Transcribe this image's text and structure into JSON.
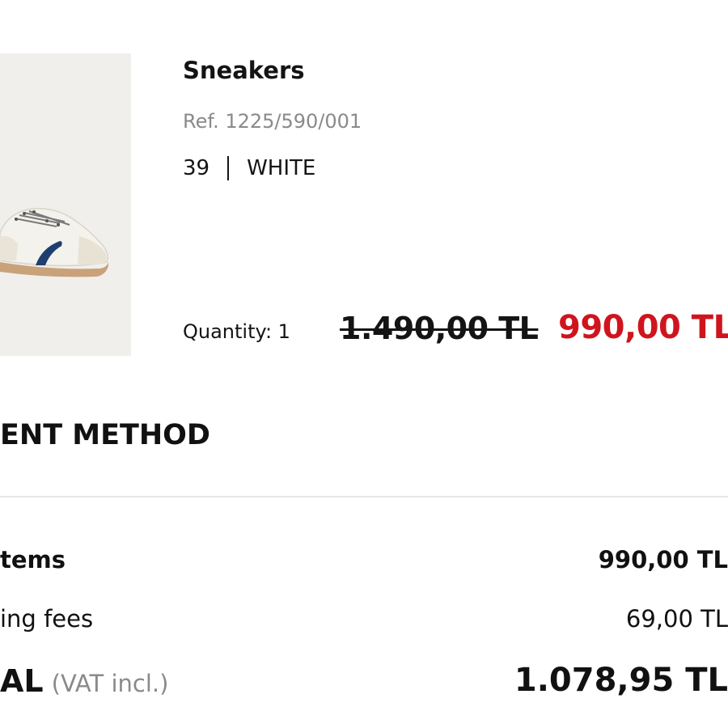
{
  "product": {
    "name": "Sneakers",
    "reference": "Ref. 1225/590/001",
    "size": "39",
    "color": "WHITE",
    "quantity_label": "Quantity: 1",
    "original_price": "1.490,00 TL",
    "sale_price": "990,00 TL",
    "sale_price_color": "#d0141e",
    "image_icon": "sneaker-image"
  },
  "payment": {
    "section_title": "ENT METHOD"
  },
  "summary": {
    "items_label": "tems",
    "items_value": "990,00 TL",
    "shipping_label": "ing fees",
    "shipping_value": "69,00 TL",
    "total_label": "AL",
    "total_vat_note": "(VAT incl.)",
    "total_value": "1.078,95 TL"
  }
}
